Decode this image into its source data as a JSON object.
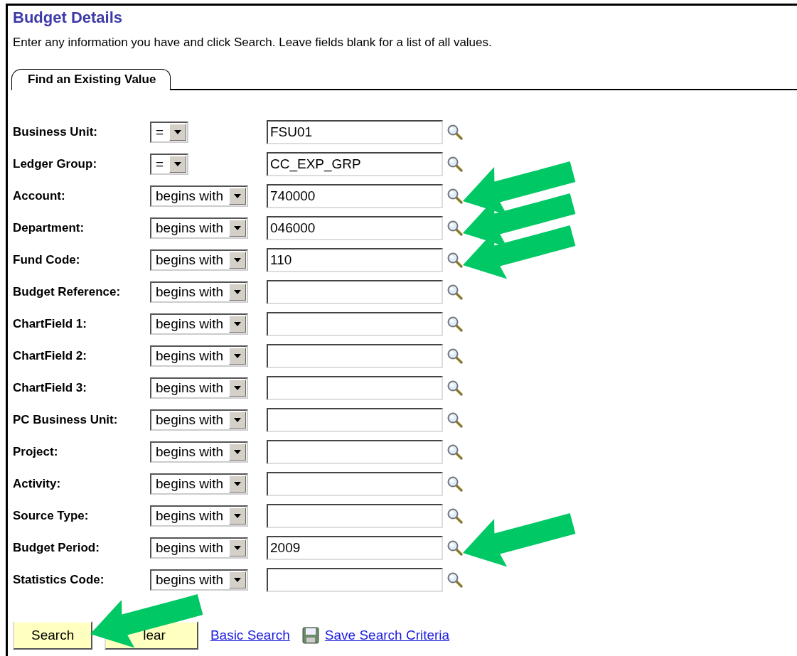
{
  "page": {
    "title": "Budget Details",
    "instructions": "Enter any information you have and click Search. Leave fields blank for a list of all values."
  },
  "tabs": [
    {
      "label": "Find an Existing Value",
      "selected": true
    }
  ],
  "fields": [
    {
      "label": "Business Unit:",
      "operator": "=",
      "value": "FSU01",
      "highlighted": false
    },
    {
      "label": "Ledger Group:",
      "operator": "=",
      "value": "CC_EXP_GRP",
      "highlighted": false
    },
    {
      "label": "Account:",
      "operator": "begins with",
      "value": "740000",
      "highlighted": true
    },
    {
      "label": "Department:",
      "operator": "begins with",
      "value": "046000",
      "highlighted": true
    },
    {
      "label": "Fund Code:",
      "operator": "begins with",
      "value": "110",
      "highlighted": true
    },
    {
      "label": "Budget Reference:",
      "operator": "begins with",
      "highlighted": false
    },
    {
      "label": "ChartField 1:",
      "operator": "begins with",
      "highlighted": false
    },
    {
      "label": "ChartField 2:",
      "operator": "begins with",
      "highlighted": false
    },
    {
      "label": "ChartField 3:",
      "operator": "begins with",
      "highlighted": false
    },
    {
      "label": "PC Business Unit:",
      "operator": "begins with",
      "highlighted": false
    },
    {
      "label": "Project:",
      "operator": "begins with",
      "highlighted": false
    },
    {
      "label": "Activity:",
      "operator": "begins with",
      "highlighted": false
    },
    {
      "label": "Source Type:",
      "operator": "begins with",
      "highlighted": false
    },
    {
      "label": "Budget Period:",
      "operator": "begins with",
      "value": "2009",
      "highlighted": true
    },
    {
      "label": "Statistics Code:",
      "operator": "begins with",
      "highlighted": false
    }
  ],
  "buttons": [
    {
      "label": "Search"
    },
    {
      "label": "lear"
    }
  ],
  "annotations": [
    {
      "kind": "arrow"
    }
  ],
  "links": [
    {
      "kind": "link",
      "label": "Basic Search"
    },
    {
      "kind": "save",
      "label": "Save Search Criteria"
    }
  ]
}
